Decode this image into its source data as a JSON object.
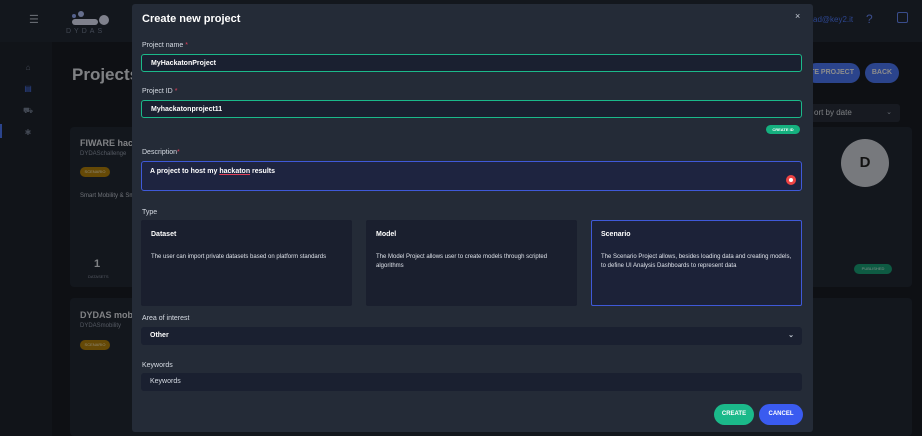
{
  "header": {
    "logo_text": "DYDAS",
    "email_fragment": "ad@key2.it",
    "help_label": "?"
  },
  "background": {
    "page_title": "Projects",
    "create_project_label": "TE PROJECT",
    "back_label": "BACK",
    "sort_label": "ort by date",
    "card1": {
      "title": "FIWARE hacl",
      "subtitle": "DYDASchallenge",
      "badge": "SCENARIO",
      "description": "Smart Mobility & Sm",
      "count": "1",
      "count_label": "DATASETS",
      "avatar": "D",
      "status": "PUBLISHED"
    },
    "card2": {
      "title": "DYDAS mobi",
      "subtitle": "DYDASmobility",
      "badge": "SCENARIO"
    }
  },
  "modal": {
    "title": "Create new project",
    "close_label": "×",
    "project_name": {
      "label": "Project name",
      "value": "MyHackatonProject"
    },
    "project_id": {
      "label": "Project ID",
      "value": "Myhackatonproject11",
      "generate_label": "CREATE ID"
    },
    "description": {
      "label": "Description",
      "value_before": "A project to host my ",
      "value_underlined": "hackaton",
      "value_after": " results"
    },
    "type": {
      "label": "Type",
      "options": [
        {
          "title": "Dataset",
          "description": "The user can import private datasets based on platform standards"
        },
        {
          "title": "Model",
          "description": "The Model Project allows user to create models through scripted algorithms"
        },
        {
          "title": "Scenario",
          "description": "The Scenario Project allows, besides loading data and creating models, to define UI Analysis Dashboards to represent data"
        }
      ],
      "selected": "Scenario"
    },
    "area_of_interest": {
      "label": "Area of interest",
      "value": "Other"
    },
    "keywords": {
      "label": "Keywords",
      "placeholder": "Keywords"
    },
    "create_label": "CREATE",
    "cancel_label": "CANCEL"
  },
  "colors": {
    "accent_blue": "#4f7cff",
    "accent_green": "#1bb98a",
    "modal_bg": "#242b37",
    "required": "#e0405a"
  }
}
